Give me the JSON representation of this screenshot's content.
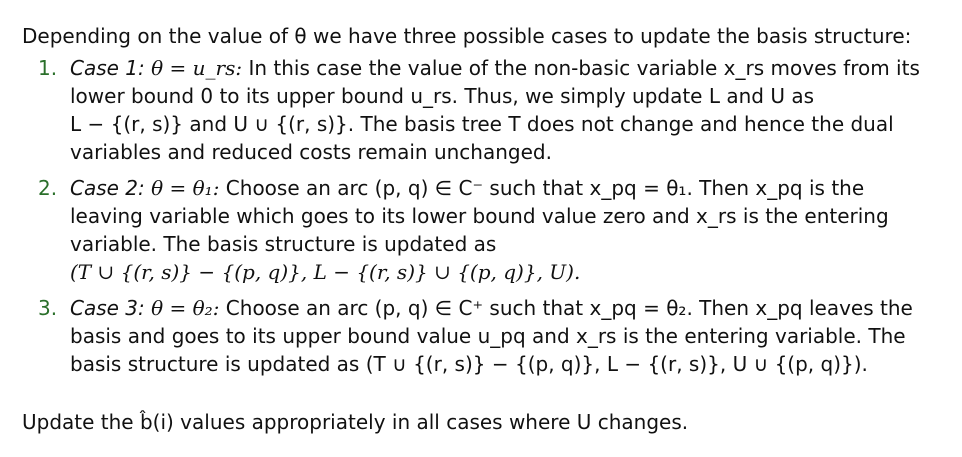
{
  "intro": "Depending on the value of θ we have three possible cases to update the basis structure:",
  "items": [
    {
      "number": "1.",
      "case": "Case 1:",
      "condition": "θ = u_rs:",
      "text_lines": [
        "In this case the value of the non-basic variable x_rs moves from its",
        "lower bound 0 to its upper bound u_rs. Thus, we simply update L and U as",
        "L − {(r, s)} and U ∪ {(r, s)}. The basis tree T does not change and hence the dual",
        "variables and reduced costs remain unchanged."
      ]
    },
    {
      "number": "2.",
      "case": "Case 2:",
      "condition": "θ = θ₁:",
      "text_lines": [
        "Choose an arc (p, q) ∈ C⁻ such that x_pq = θ₁. Then x_pq is the",
        "leaving variable which goes to its lower bound value zero and x_rs is the entering",
        "variable. The basis structure is updated as",
        "(T ∪ {(r, s)} − {(p, q)}, L − {(r, s)} ∪ {(p, q)}, U)."
      ]
    },
    {
      "number": "3.",
      "case": "Case 3:",
      "condition": "θ = θ₂:",
      "text_lines": [
        "Choose an arc (p, q) ∈ C⁺ such that x_pq = θ₂. Then x_pq leaves the",
        "basis and goes to its upper bound value u_pq and x_rs is the entering variable. The",
        "basis structure is updated as (T ∪ {(r, s)} − {(p, q)}, L − {(r, s)}, U ∪ {(p, q)})."
      ]
    }
  ],
  "outro": "Update the b̂(i) values appropriately in all cases where U changes."
}
